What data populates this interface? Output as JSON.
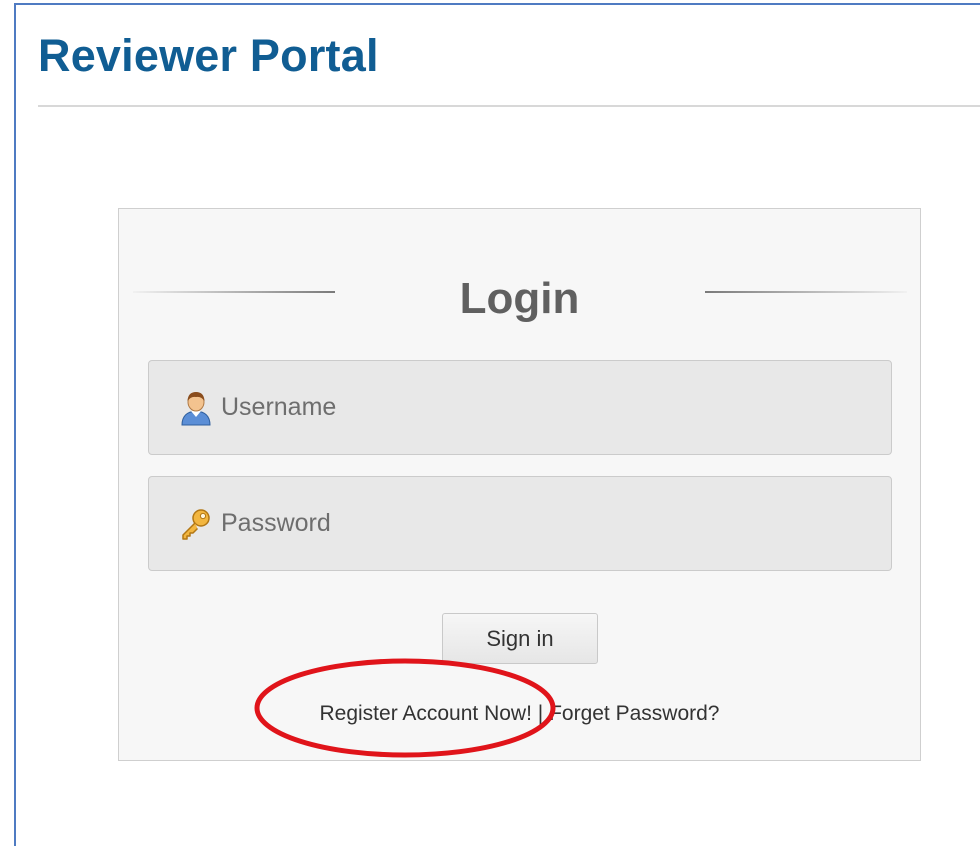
{
  "header": {
    "title": "Reviewer Portal"
  },
  "login": {
    "heading": "Login",
    "username": {
      "placeholder": "Username",
      "icon": "user-icon"
    },
    "password": {
      "placeholder": "Password",
      "icon": "key-icon"
    },
    "sign_in_label": "Sign in",
    "register_link": "Register Account Now!",
    "separator": "|",
    "forgot_link": "Forget Password?"
  },
  "colors": {
    "title": "#105d93",
    "frame_border": "#4f7bc2",
    "annotation": "#e0141a"
  }
}
